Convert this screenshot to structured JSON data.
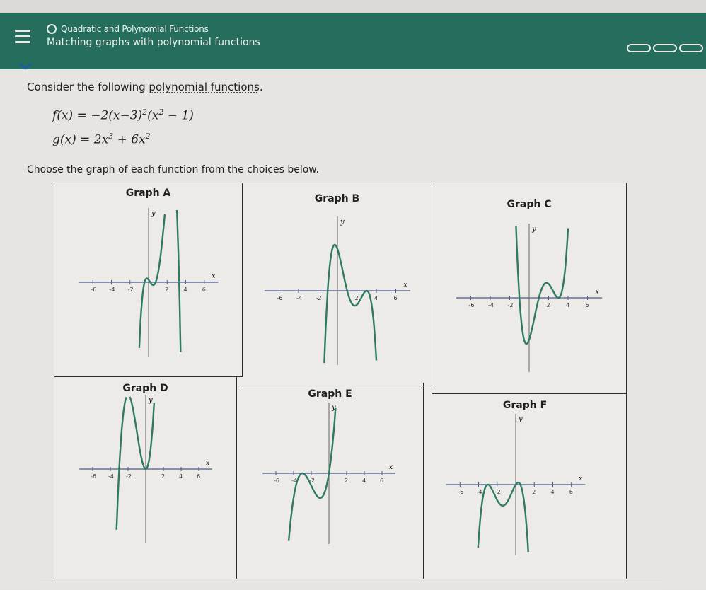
{
  "header": {
    "topic": "Quadratic and Polynomial Functions",
    "title": "Matching graphs with polynomial functions"
  },
  "question": {
    "intro_before": "Consider the following ",
    "intro_link": "polynomial functions",
    "intro_after": ".",
    "f_label": "f(x) = −2(x−3)",
    "f_exp1": "2",
    "f_part2": "(x",
    "f_exp2": "2",
    "f_part3": " − 1)",
    "g_label": "g(x) = 2x",
    "g_exp1": "3",
    "g_part2": " + 6x",
    "g_exp2": "2",
    "choose": "Choose the graph of each function from the choices below."
  },
  "graphs": [
    {
      "id": "A",
      "label": "Graph A"
    },
    {
      "id": "B",
      "label": "Graph B"
    },
    {
      "id": "C",
      "label": "Graph C"
    },
    {
      "id": "D",
      "label": "Graph D"
    },
    {
      "id": "E",
      "label": "Graph E"
    },
    {
      "id": "F",
      "label": "Graph F"
    }
  ],
  "axes": {
    "x_label": "x",
    "y_label": "y",
    "x_ticks": [
      "-6",
      "-4",
      "-2",
      "2",
      "4",
      "6"
    ]
  },
  "colors": {
    "header": "#256e5e",
    "curve": "#2f7a62",
    "axis": "#4a5a8a"
  }
}
